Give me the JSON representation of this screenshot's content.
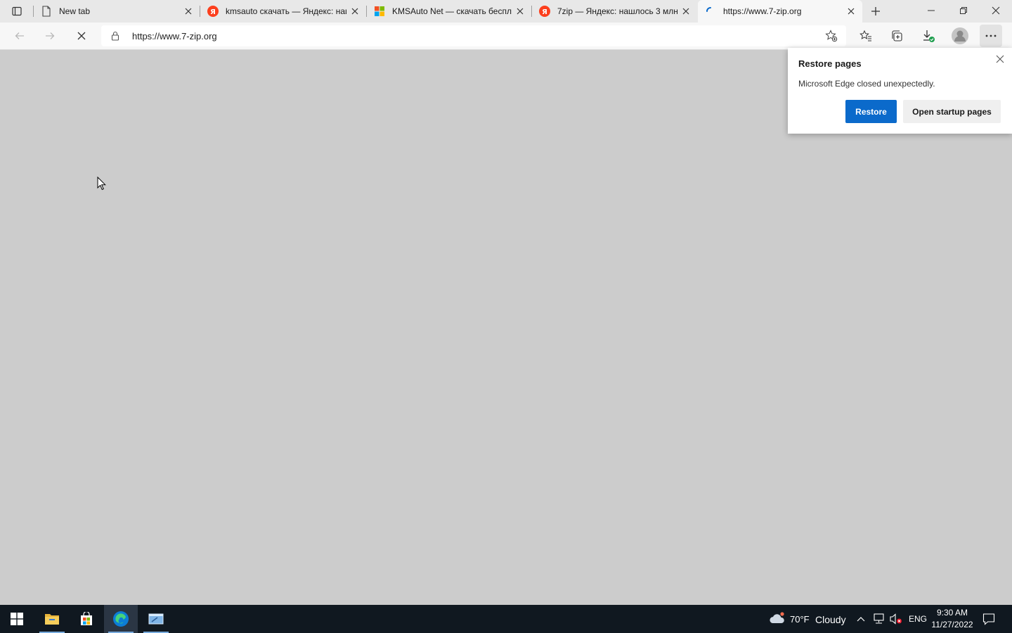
{
  "browser": {
    "tabs": [
      {
        "title": "New tab",
        "favicon": "page-icon"
      },
      {
        "title": "kmsauto скачать — Яндекс: нашлось",
        "favicon": "yandex-icon"
      },
      {
        "title": "KMSAuto Net — скачать бесплатно",
        "favicon": "windows-logo-icon"
      },
      {
        "title": "7zip — Яндекс: нашлось 3 млн",
        "favicon": "yandex-icon"
      },
      {
        "title": "https://www.7-zip.org",
        "favicon": "loading-spinner-icon"
      }
    ],
    "active_tab": 4,
    "address_bar": {
      "url": "https://www.7-zip.org"
    }
  },
  "restore_popup": {
    "title": "Restore pages",
    "message": "Microsoft Edge closed unexpectedly.",
    "restore_label": "Restore",
    "startup_label": "Open startup pages"
  },
  "taskbar": {
    "weather": {
      "temp": "70°F",
      "condition": "Cloudy"
    },
    "language": "ENG",
    "time": "9:30 AM",
    "date": "11/27/2022"
  },
  "colors": {
    "accent": "#0b6acb",
    "page_background": "#cccccc",
    "taskbar": "#101820"
  }
}
